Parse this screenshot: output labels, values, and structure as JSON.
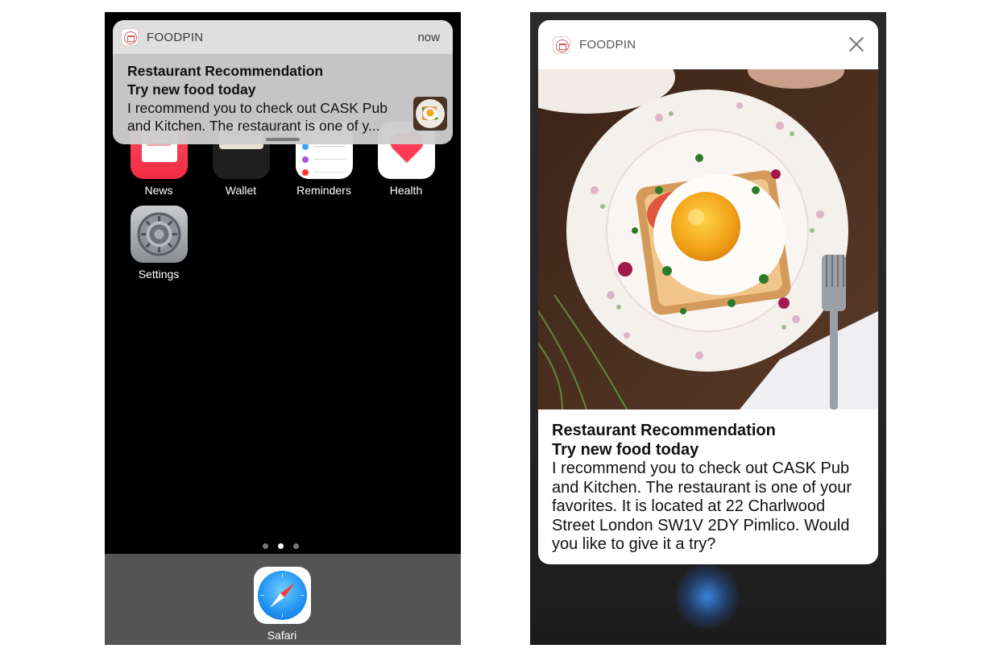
{
  "notification": {
    "app_name": "FOODPIN",
    "time": "now",
    "title": "Restaurant Recommendation",
    "subtitle": "Try new food today",
    "body_truncated": "I recommend you to check out CASK Pub and Kitchen. The restaurant is one of y...",
    "body_full": "I recommend you to check out CASK Pub and Kitchen. The restaurant is one of your favorites. It is located at 22 Charlwood Street London SW1V 2DY Pimlico. Would you like to give it a try?"
  },
  "home_screen": {
    "apps": [
      {
        "label": "News",
        "icon": "news-icon"
      },
      {
        "label": "Wallet",
        "icon": "wallet-icon"
      },
      {
        "label": "Reminders",
        "icon": "reminders-icon"
      },
      {
        "label": "Health",
        "icon": "health-icon"
      },
      {
        "label": "Settings",
        "icon": "settings-gear-icon"
      }
    ],
    "page_indicator": {
      "pages": 3,
      "current": 2
    },
    "dock": [
      {
        "label": "Safari",
        "icon": "safari-compass-icon"
      }
    ]
  },
  "colors": {
    "news_red": "#f12b44",
    "health_red": "#ff3b55",
    "reminder_dots": [
      "#ff9500",
      "#34a8ff",
      "#ff3b30",
      "#af52de"
    ],
    "dock_gray": "#545454",
    "siri_blue": "#3c96ff"
  }
}
